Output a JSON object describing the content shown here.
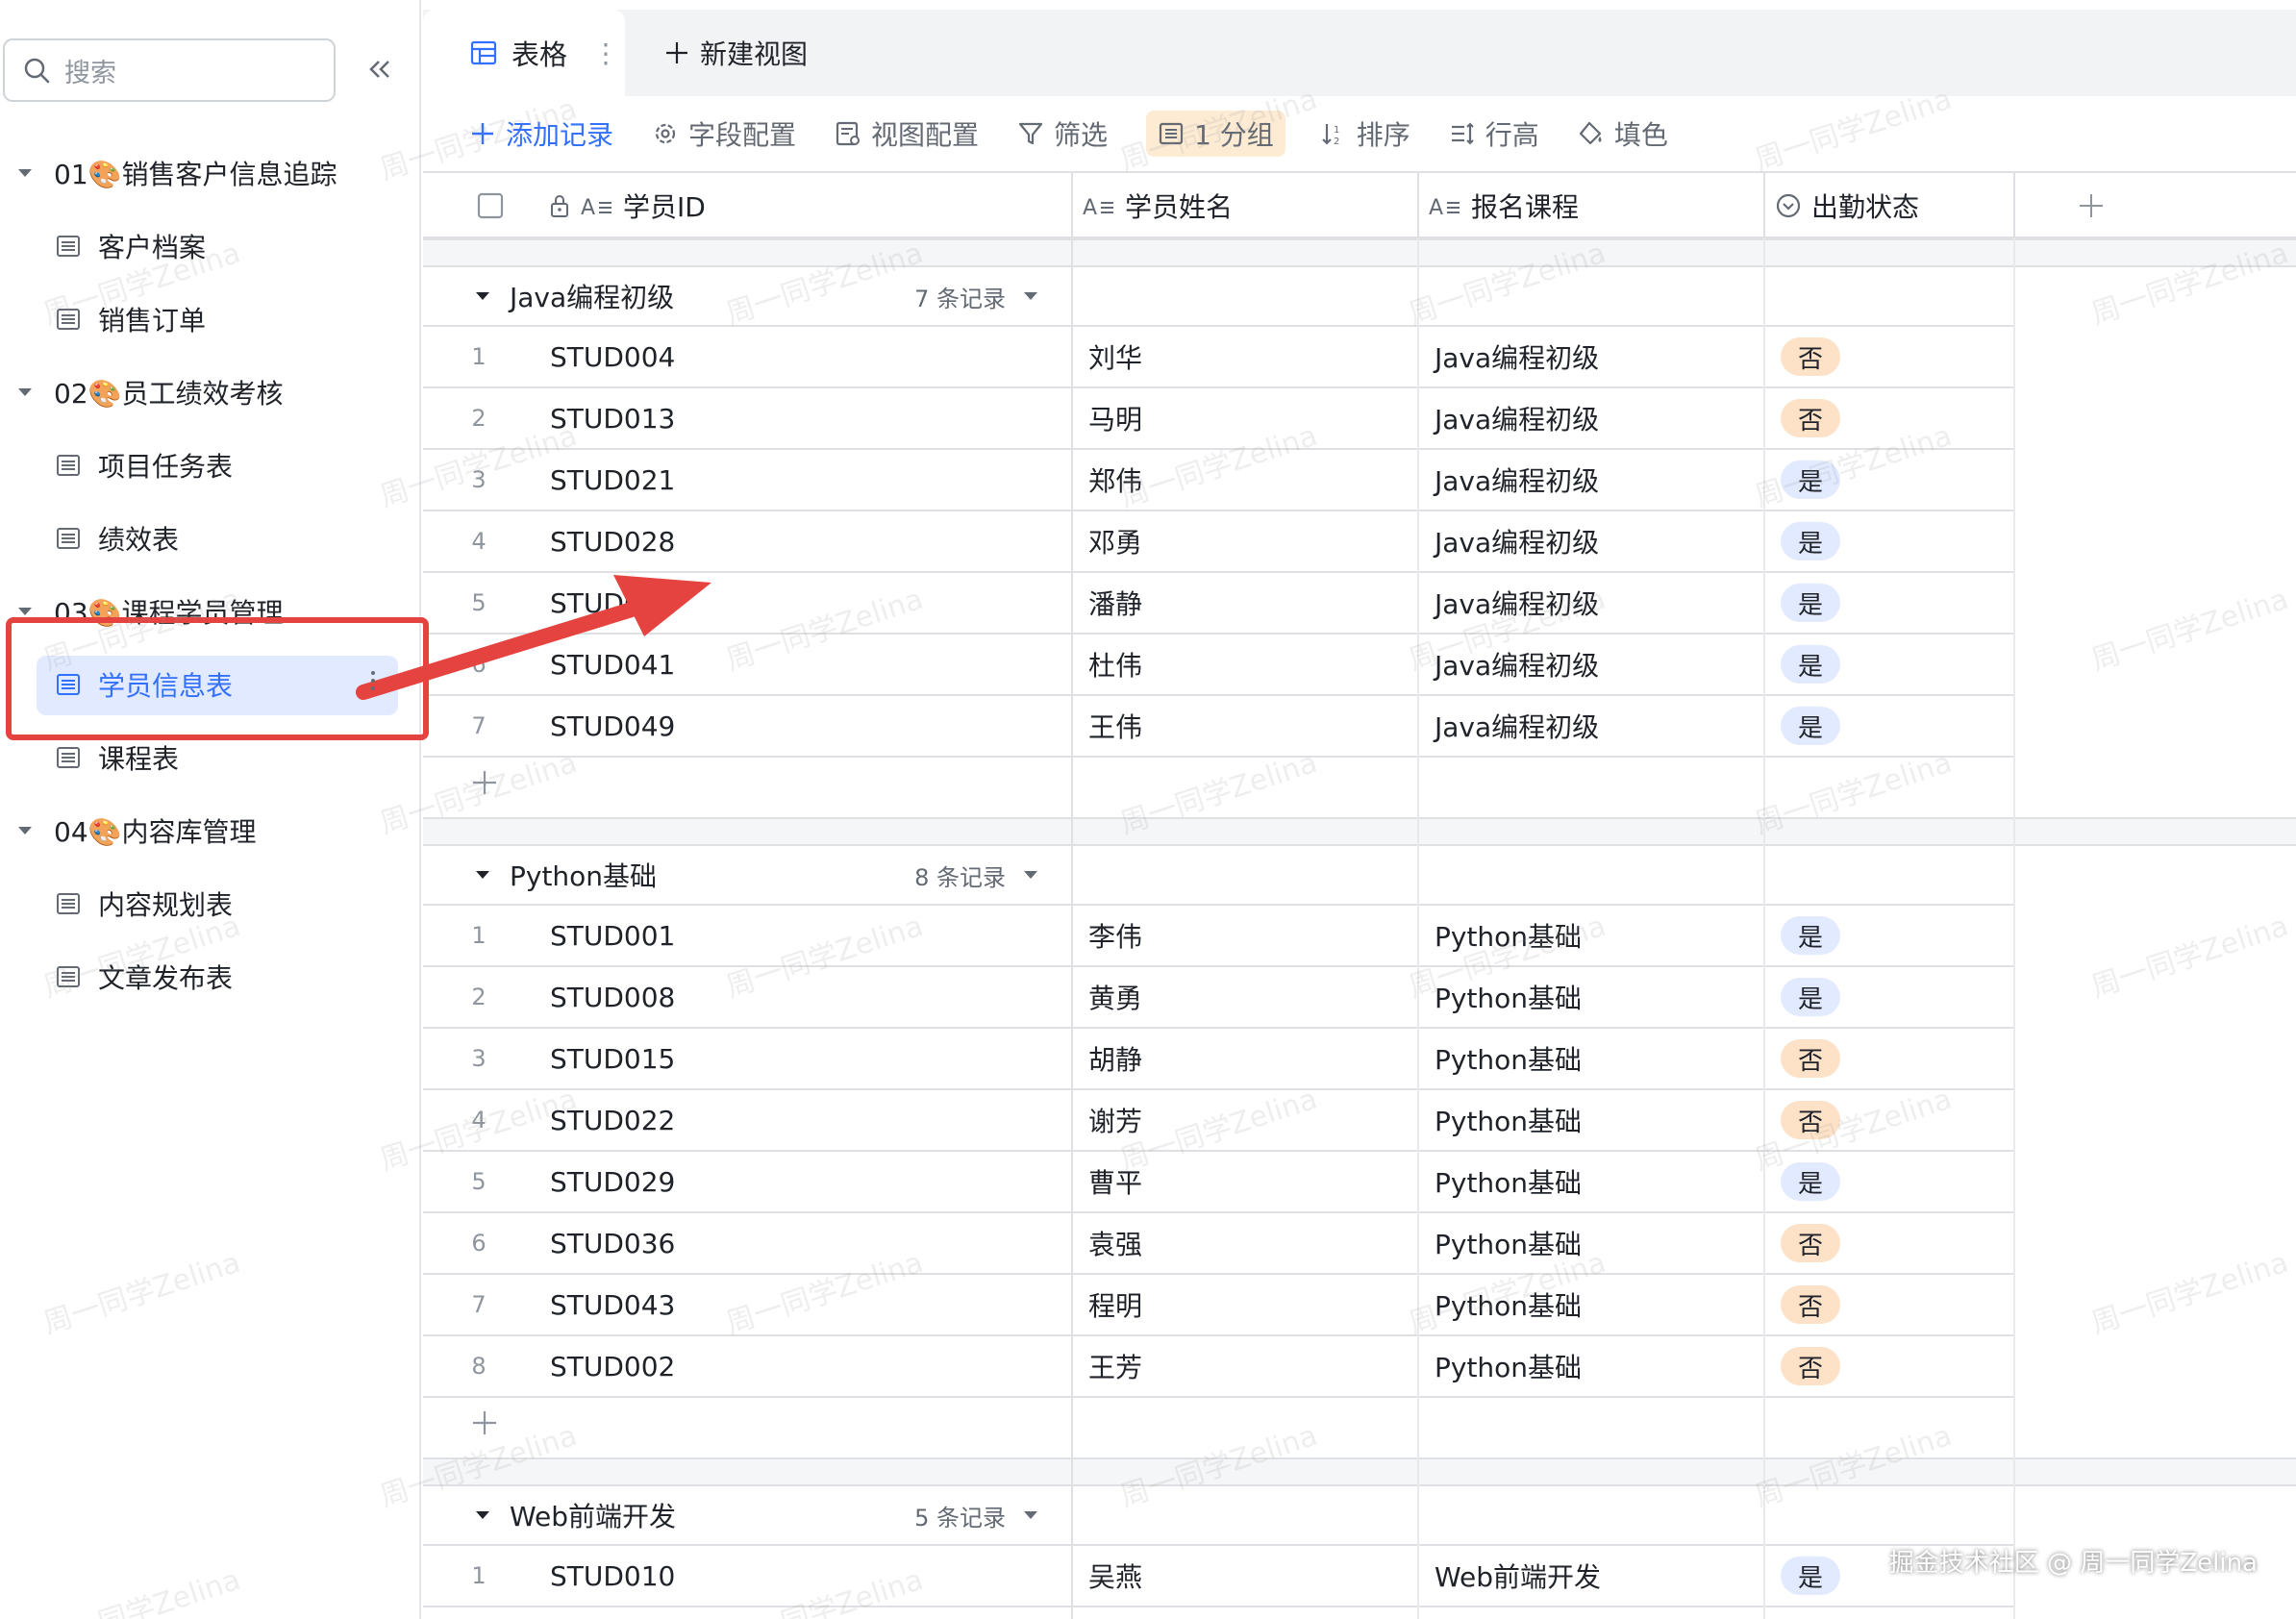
{
  "sidebar": {
    "search_placeholder": "搜索",
    "folders": [
      {
        "label": "01🎨销售客户信息追踪",
        "tables": [
          "客户档案",
          "销售订单"
        ]
      },
      {
        "label": "02🎨员工绩效考核",
        "tables": [
          "项目任务表",
          "绩效表"
        ]
      },
      {
        "label": "03🎨课程学员管理",
        "tables": [
          "学员信息表",
          "课程表"
        ]
      },
      {
        "label": "04🎨内容库管理",
        "tables": [
          "内容规划表",
          "文章发布表"
        ]
      }
    ],
    "active_table": "学员信息表"
  },
  "tabs": {
    "active": "表格",
    "new_view": "新建视图"
  },
  "toolbar": {
    "add_record": "添加记录",
    "field_config": "字段配置",
    "view_config": "视图配置",
    "filter": "筛选",
    "group": "1 分组",
    "sort": "排序",
    "row_height": "行高",
    "fill_color": "填色"
  },
  "columns": [
    "学员ID",
    "学员姓名",
    "报名课程",
    "出勤状态"
  ],
  "groups": [
    {
      "name": "Java编程初级",
      "count": "7 条记录",
      "rows": [
        {
          "idx": "1",
          "id": "STUD004",
          "name": "刘华",
          "course": "Java编程初级",
          "att": "否"
        },
        {
          "idx": "2",
          "id": "STUD013",
          "name": "马明",
          "course": "Java编程初级",
          "att": "否"
        },
        {
          "idx": "3",
          "id": "STUD021",
          "name": "郑伟",
          "course": "Java编程初级",
          "att": "是"
        },
        {
          "idx": "4",
          "id": "STUD028",
          "name": "邓勇",
          "course": "Java编程初级",
          "att": "是"
        },
        {
          "idx": "5",
          "id": "STUD0",
          "name": "潘静",
          "course": "Java编程初级",
          "att": "是"
        },
        {
          "idx": "6",
          "id": "STUD041",
          "name": "杜伟",
          "course": "Java编程初级",
          "att": "是"
        },
        {
          "idx": "7",
          "id": "STUD049",
          "name": "王伟",
          "course": "Java编程初级",
          "att": "是"
        }
      ]
    },
    {
      "name": "Python基础",
      "count": "8 条记录",
      "rows": [
        {
          "idx": "1",
          "id": "STUD001",
          "name": "李伟",
          "course": "Python基础",
          "att": "是"
        },
        {
          "idx": "2",
          "id": "STUD008",
          "name": "黄勇",
          "course": "Python基础",
          "att": "是"
        },
        {
          "idx": "3",
          "id": "STUD015",
          "name": "胡静",
          "course": "Python基础",
          "att": "否"
        },
        {
          "idx": "4",
          "id": "STUD022",
          "name": "谢芳",
          "course": "Python基础",
          "att": "否"
        },
        {
          "idx": "5",
          "id": "STUD029",
          "name": "曹平",
          "course": "Python基础",
          "att": "是"
        },
        {
          "idx": "6",
          "id": "STUD036",
          "name": "袁强",
          "course": "Python基础",
          "att": "否"
        },
        {
          "idx": "7",
          "id": "STUD043",
          "name": "程明",
          "course": "Python基础",
          "att": "否"
        },
        {
          "idx": "8",
          "id": "STUD002",
          "name": "王芳",
          "course": "Python基础",
          "att": "否"
        }
      ]
    },
    {
      "name": "Web前端开发",
      "count": "5 条记录",
      "rows": [
        {
          "idx": "1",
          "id": "STUD010",
          "name": "吴燕",
          "course": "Web前端开发",
          "att": "是"
        }
      ]
    }
  ],
  "watermark": "周一同学Zelina",
  "credit": "掘金技术社区 @ 周一同学Zelina",
  "colors": {
    "accent": "#3370ff",
    "yes_tag": "#e1eaff",
    "no_tag": "#fde2c8",
    "annotation_red": "#e5433f"
  }
}
